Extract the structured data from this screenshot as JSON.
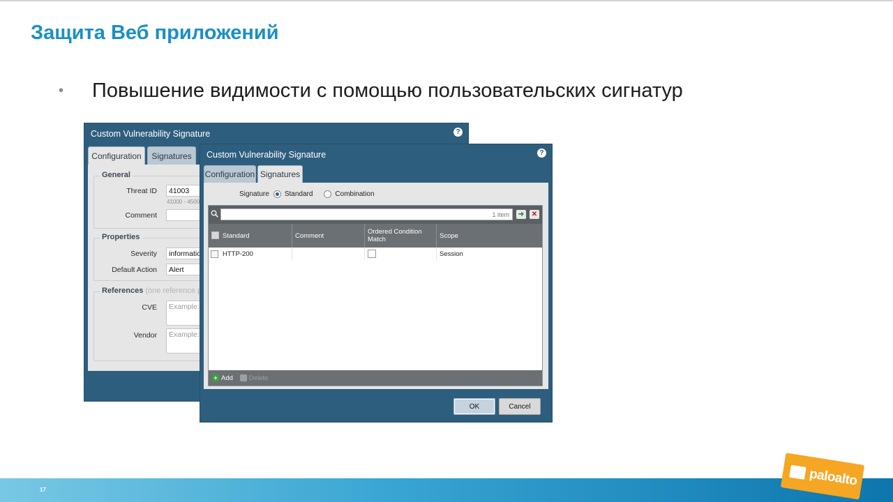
{
  "slide": {
    "title": "Защита Веб приложений",
    "bullet": "Повышение видимости с помощью пользовательских сигнатур",
    "page_number": "17"
  },
  "back_dialog": {
    "title": "Custom Vulnerability Signature",
    "tabs": [
      "Configuration",
      "Signatures"
    ],
    "general_legend": "General",
    "threat_id_label": "Threat ID",
    "threat_id_value": "41003",
    "threat_id_range": "41000 - 4500",
    "comment_label": "Comment",
    "properties_legend": "Properties",
    "severity_label": "Severity",
    "severity_value": "informatio",
    "default_action_label": "Default Action",
    "default_action_value": "Alert",
    "references_legend": "References",
    "references_hint": "(one reference p",
    "cve_label": "CVE",
    "cve_placeholder": "Example: C",
    "vendor_label": "Vendor",
    "vendor_placeholder": "Example: S"
  },
  "front_dialog": {
    "title": "Custom Vulnerability Signature",
    "tabs": [
      "Configuration",
      "Signatures"
    ],
    "signature_label": "Signature",
    "options": [
      "Standard",
      "Combination"
    ],
    "selected_option": "Standard",
    "item_count": "1 item",
    "columns": [
      "Standard",
      "Comment",
      "Ordered Condition Match",
      "Scope"
    ],
    "rows": [
      {
        "standard": "HTTP-200",
        "comment": "",
        "ordered": false,
        "scope": "Session"
      }
    ],
    "add_label": "Add",
    "delete_label": "Delete",
    "ok_label": "OK",
    "cancel_label": "Cancel"
  },
  "logo": {
    "text": "paloalto"
  },
  "colors": {
    "title": "#1b8fc4",
    "dialog_chrome": "#2e5e7e",
    "logo": "#f5a623"
  }
}
